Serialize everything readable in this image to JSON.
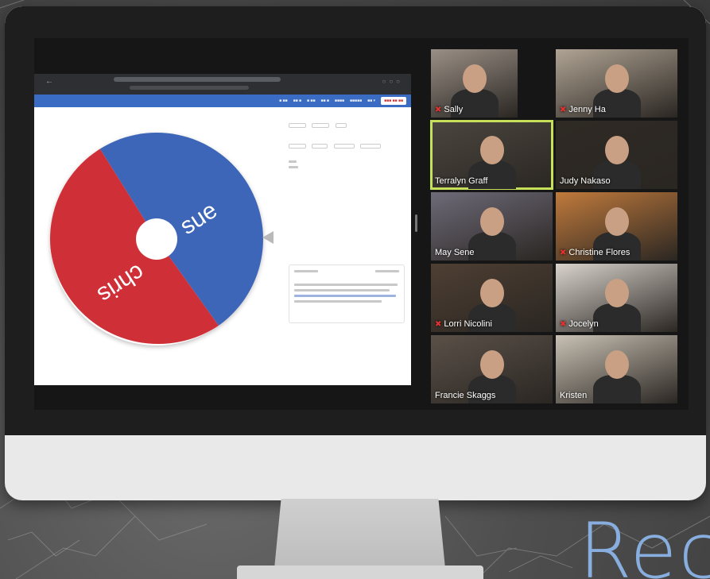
{
  "wheel": {
    "entries": [
      {
        "label": "sue",
        "color": "#3d66b8"
      },
      {
        "label": "chris",
        "color": "#cf2f36"
      }
    ]
  },
  "participants": [
    {
      "name": "Sally",
      "muted": true,
      "bg": "#9a8f86"
    },
    {
      "name": "Jenny Ha",
      "muted": true,
      "bg": "#b0a494"
    },
    {
      "name": "Terralyn Graff",
      "muted": false,
      "active": true,
      "bg": "#4b463f"
    },
    {
      "name": "Judy Nakaso",
      "muted": false,
      "bg": "#2f2a24"
    },
    {
      "name": "May Sene",
      "muted": false,
      "bg": "#6e6a78"
    },
    {
      "name": "Christine Flores",
      "muted": true,
      "bg": "#c07a3c"
    },
    {
      "name": "Lorri Nicolini",
      "muted": true,
      "bg": "#4e3f33"
    },
    {
      "name": "Jocelyn",
      "muted": true,
      "bg": "#d9d3cc"
    },
    {
      "name": "Francie Skaggs",
      "muted": false,
      "bg": "#5a5048"
    },
    {
      "name": "Kristen",
      "muted": false,
      "bg": "#c9c1b4"
    }
  ],
  "overlay_text": "Rec",
  "colors": {
    "accent_blue": "#3b6cc4",
    "active_speaker_border": "#c7e05a",
    "overlay_text": "#87aede"
  }
}
